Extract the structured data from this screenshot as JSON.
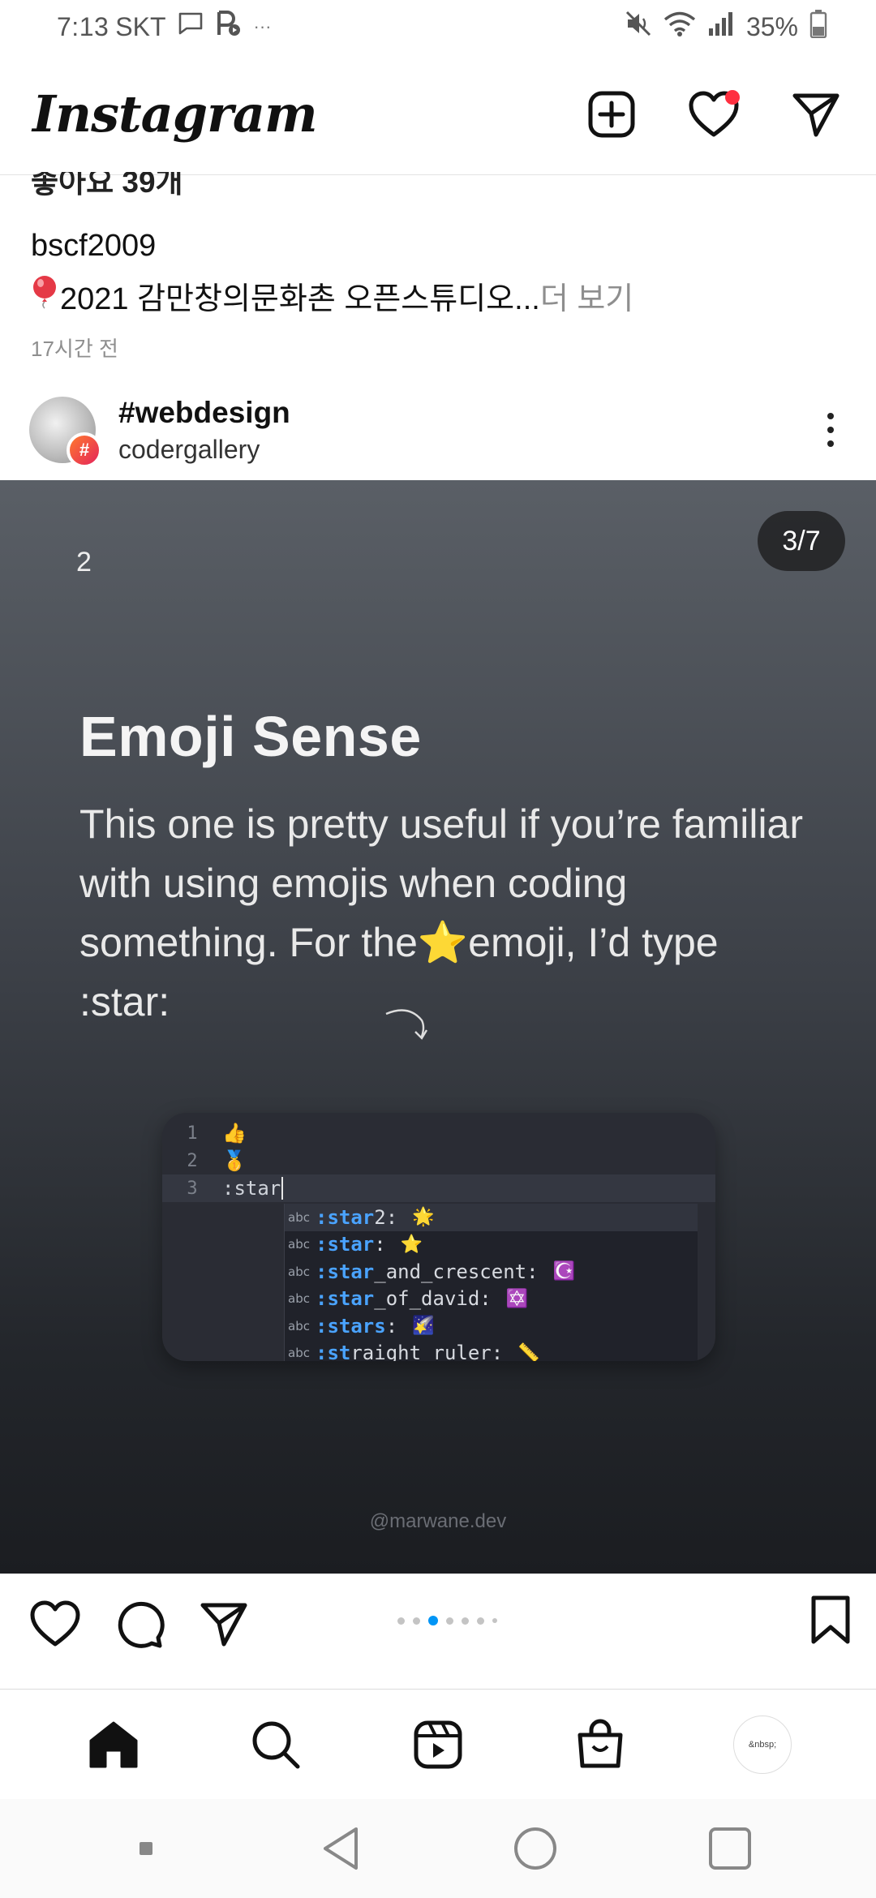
{
  "status_bar": {
    "time": "7:13",
    "carrier": "SKT",
    "overflow": "···",
    "battery": "35%",
    "icons": [
      "chat-bubble-icon",
      "play-store-icon",
      "mute-icon",
      "wifi-icon",
      "signal-icon",
      "battery-icon"
    ]
  },
  "header": {
    "logo": "Instagram",
    "actions": [
      "new-post-icon",
      "heart-icon",
      "direct-message-icon"
    ],
    "accent": "#ff3040"
  },
  "prev_post": {
    "likes": "좋아요 39개",
    "username": "bscf2009",
    "caption": "2021 감만창의문화촌 오픈스튜디오...",
    "more": " 더 보기",
    "time": "17시간 전"
  },
  "post": {
    "hashtag": "#webdesign",
    "author": "codergallery",
    "hash_badge": "#",
    "counter": "3/7",
    "slide": {
      "number": "2",
      "title": "Emoji Sense",
      "body_1": "This one is pretty useful if you’re familiar with using emojis when coding something. For the",
      "star": "⭐",
      "body_2": "emoji, I’d type :star:",
      "watermark": "@marwane.dev"
    },
    "editor": {
      "lines": [
        {
          "num": "1",
          "text": "👍"
        },
        {
          "num": "2",
          "text": "🥇"
        },
        {
          "num": "3",
          "text": ":star"
        }
      ],
      "suggestions": [
        {
          "abc": "abc",
          "match": ":star",
          "rest": "2:",
          "icon": "🌟"
        },
        {
          "abc": "abc",
          "match": ":star",
          "rest": ":",
          "icon": "⭐"
        },
        {
          "abc": "abc",
          "match": ":star",
          "rest": "_and_crescent:",
          "icon": "☪️"
        },
        {
          "abc": "abc",
          "match": ":star",
          "rest": "_of_david:",
          "icon": "✡️"
        },
        {
          "abc": "abc",
          "match": ":stars",
          "rest": ":",
          "icon": "🌠"
        },
        {
          "abc": "abc",
          "match": ":st",
          "rest": "raight_ruler:",
          "icon": "📏"
        }
      ]
    }
  },
  "actions": [
    "like-icon",
    "comment-icon",
    "share-icon",
    "save-icon"
  ],
  "carousel_dots": {
    "count": 7,
    "active_index": 2,
    "active_color": "#0095f6"
  },
  "bottom_nav": {
    "items": [
      "home-icon",
      "search-icon",
      "reels-icon",
      "shop-icon"
    ],
    "profile_text": "&nbsp;"
  },
  "system_nav": [
    "recent-apps-icon",
    "back-icon",
    "home-circle-icon",
    "overview-icon"
  ]
}
